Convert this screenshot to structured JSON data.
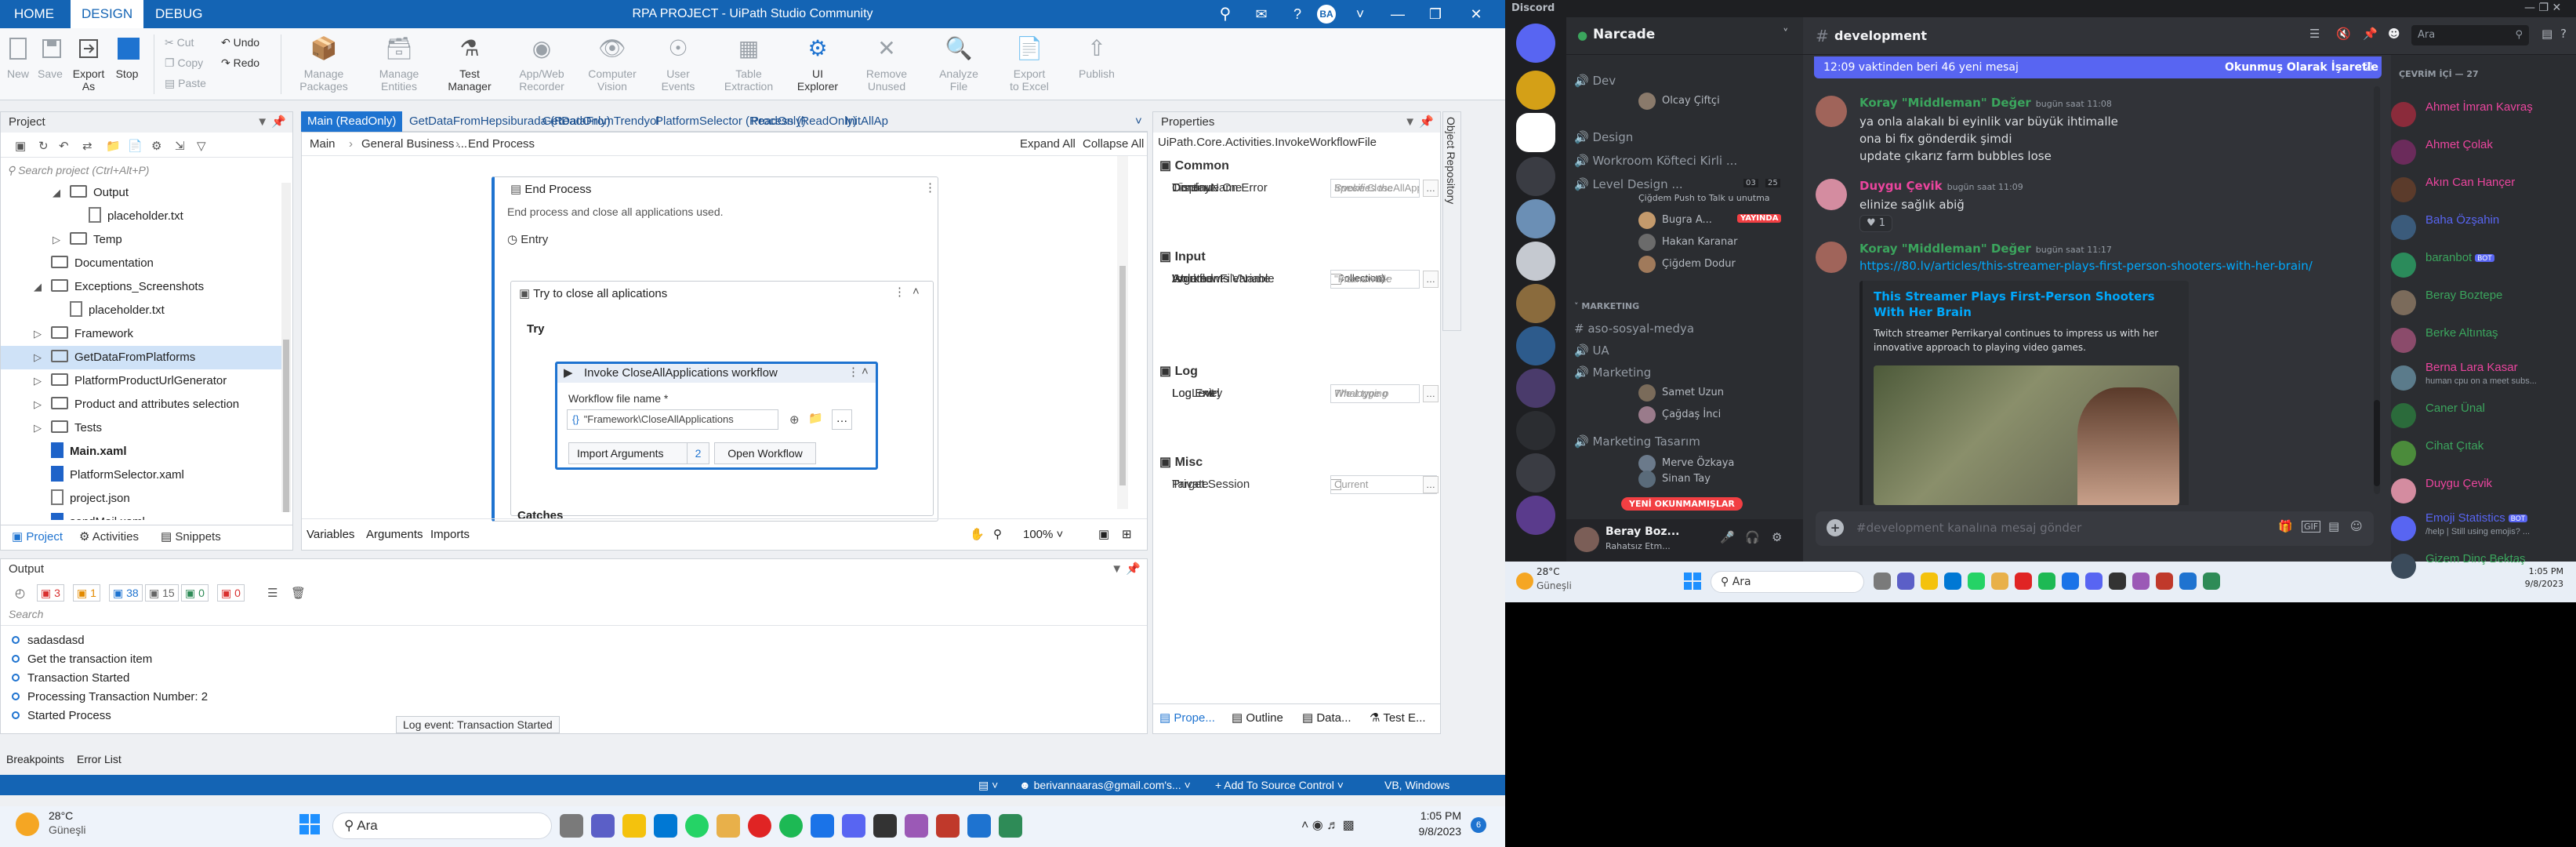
{
  "uipath": {
    "title": "RPA PROJECT - UiPath Studio Community",
    "tabs": [
      "HOME",
      "DESIGN",
      "DEBUG"
    ],
    "avatar": "BA",
    "ribbon": {
      "new": "New",
      "save": "Save",
      "export": "Export\nAs",
      "stop": "Stop",
      "cut": "Cut",
      "copy": "Copy",
      "paste": "Paste",
      "undo": "Undo",
      "redo": "Redo",
      "big": [
        {
          "label": "Manage\nPackages",
          "dis": true
        },
        {
          "label": "Manage\nEntities",
          "dis": true
        },
        {
          "label": "Test\nManager",
          "dis": false
        },
        {
          "label": "App/Web\nRecorder",
          "dis": true
        },
        {
          "label": "Computer\nVision",
          "dis": true
        },
        {
          "label": "User\nEvents",
          "dis": true
        },
        {
          "label": "Table\nExtraction",
          "dis": true
        },
        {
          "label": "UI\nExplorer",
          "dis": false
        },
        {
          "label": "Remove\nUnused",
          "dis": true
        },
        {
          "label": "Analyze\nFile",
          "dis": true
        },
        {
          "label": "Export\nto Excel",
          "dis": true
        },
        {
          "label": "Publish",
          "dis": true
        }
      ]
    },
    "project": {
      "title": "Project",
      "search_placeholder": "Search project (Ctrl+Alt+P)",
      "items": [
        {
          "label": "Output",
          "type": "folder",
          "level": 1,
          "open": true
        },
        {
          "label": "placeholder.txt",
          "type": "file",
          "level": 2
        },
        {
          "label": "Temp",
          "type": "folder",
          "level": 1,
          "open": false
        },
        {
          "label": "Documentation",
          "type": "folder",
          "level": 0,
          "open": null
        },
        {
          "label": "Exceptions_Screenshots",
          "type": "folder",
          "level": 0,
          "open": true
        },
        {
          "label": "placeholder.txt",
          "type": "file",
          "level": 1
        },
        {
          "label": "Framework",
          "type": "folder",
          "level": 0,
          "open": false
        },
        {
          "label": "GetDataFromPlatforms",
          "type": "folder",
          "level": 0,
          "open": false,
          "selected": true
        },
        {
          "label": "PlatformProductUrlGenerator",
          "type": "folder",
          "level": 0,
          "open": false
        },
        {
          "label": "Product and attributes selection",
          "type": "folder",
          "level": 0,
          "open": false
        },
        {
          "label": "Tests",
          "type": "folder",
          "level": 0,
          "open": false
        },
        {
          "label": "Main.xaml",
          "type": "xaml",
          "level": 0,
          "bold": true
        },
        {
          "label": "PlatformSelector.xaml",
          "type": "xaml",
          "level": 0
        },
        {
          "label": "project.json",
          "type": "file",
          "level": 0
        },
        {
          "label": "sendMail.xaml",
          "type": "xaml",
          "level": 0
        }
      ],
      "bottom_tabs": [
        "Project",
        "Activities",
        "Snippets"
      ]
    },
    "doc_tabs": [
      "Main (ReadOnly)",
      "GetDataFromHepsiburada (ReadOnly)",
      "GetDataFromTrendyol",
      "PlatformSelector (ReadOnly)",
      "Process (ReadOnly)",
      "InitAllAp"
    ],
    "breadcrumb": [
      "Main",
      "General Business ...",
      "End Process"
    ],
    "expand_all": "Expand All",
    "collapse_all": "Collapse All",
    "designer": {
      "end_process": "End Process",
      "end_desc": "End process and close all applications used.",
      "entry": "Entry",
      "try_catch": "Try to close all aplications",
      "try": "Try",
      "invoke": "Invoke CloseAllApplications workflow",
      "wf_label": "Workflow file name *",
      "wf_value": "\"Framework\\CloseAllApplications",
      "import_args": "Import Arguments",
      "import_count": "2",
      "open_workflow": "Open Workflow",
      "catches": "Catches",
      "bottom": [
        "Variables",
        "Arguments",
        "Imports"
      ],
      "zoom": "100%"
    },
    "properties": {
      "title": "Properties",
      "activity": "UiPath.Core.Activities.InvokeWorkflowFile",
      "sections": [
        {
          "name": "Common",
          "rows": [
            {
              "label": "Continue On Error",
              "value": "Specifie"
            },
            {
              "label": "DisplayName",
              "value": "Invoke CloseAllAppli"
            },
            {
              "label": "Timeout",
              "value": "Specifies the"
            }
          ]
        },
        {
          "name": "Input",
          "rows": [
            {
              "label": "Arguments",
              "value": "(Collection)"
            },
            {
              "label": "Arguments Variable",
              "value": "Enter a VB e"
            },
            {
              "label": "Isolated",
              "value": ""
            },
            {
              "label": "WorkflowFileName",
              "value": "\"Framework"
            }
          ]
        },
        {
          "name": "Log",
          "rows": [
            {
              "label": "Log Entry",
              "value": "What type o"
            },
            {
              "label": "Log Exit",
              "value": "What type o"
            },
            {
              "label": "LogLevel",
              "value": "The logging"
            }
          ]
        },
        {
          "name": "Misc",
          "rows": [
            {
              "label": "Private",
              "value": ""
            },
            {
              "label": "Target Session",
              "value": "Current"
            }
          ]
        }
      ],
      "bottom_tabs": [
        "Prope...",
        "Outline",
        "Data...",
        "Test E..."
      ]
    },
    "side_tab": "Object Repository",
    "output": {
      "title": "Output",
      "counts": [
        "3",
        "1",
        "38",
        "15",
        "0",
        "0"
      ],
      "search": "Search",
      "rows": [
        "sadasdasd",
        "Get the transaction item",
        "Transaction Started",
        "Processing Transaction Number: 2",
        "Started Process"
      ],
      "tooltip": "Log event: Transaction Started"
    },
    "status_tabs": [
      "Breakpoints",
      "Error List"
    ],
    "statusbar": {
      "email": "berivannaaras@gmail.com's...",
      "source": "Add To Source Control",
      "lang": "VB, Windows"
    },
    "taskbar": {
      "weather_temp": "28°C",
      "weather_desc": "Güneşli",
      "search": "Ara",
      "time": "1:05 PM",
      "date": "9/8/2023"
    }
  },
  "discord": {
    "app": "Discord",
    "server": "Narcade",
    "channel": "development",
    "new_msgs_bar": "12:09 vaktinden beri 46 yeni mesaj",
    "mark_read": "Okunmuş Olarak İşaretle",
    "search": "Ara",
    "channels": [
      {
        "type": "voice",
        "name": "Dev"
      },
      {
        "type": "voice",
        "name": "Design"
      },
      {
        "type": "voice",
        "name": "Workroom Köfteci Kirli ..."
      },
      {
        "type": "voice",
        "name": "Level Design ..."
      },
      {
        "type": "cat",
        "name": "MARKETING"
      },
      {
        "type": "text",
        "name": "aso-sosyal-medya"
      },
      {
        "type": "voice",
        "name": "UA"
      },
      {
        "type": "voice",
        "name": "Marketing"
      },
      {
        "type": "voice",
        "name": "Marketing Tasarım"
      }
    ],
    "voice_users": {
      "dev": [
        "Olcay Çiftçi"
      ],
      "level": [
        "Çiğdem Push to Talk u unutma",
        "Bugra A...",
        "Hakan Karanar",
        "Çiğdem Dodur"
      ],
      "level_live": "YAYINDA",
      "level_counts": [
        "03",
        "25"
      ],
      "marketing": [
        "Samet Uzun",
        "Çağdaş İnci"
      ],
      "tasarim": [
        "Merve Özkaya",
        "Sinan Tay"
      ]
    },
    "unread_pill": "YENİ OKUNMAMIŞLAR",
    "user": {
      "name": "Beray Boz...",
      "status": "Rahatsız Etm..."
    },
    "messages": [
      {
        "name": "Koray \"Middleman\" Değer",
        "time": "bugün saat 11:08",
        "color": "#3ba55d",
        "lines": [
          "ya onla alakalı bi eyinlik var büyük ihtimalle",
          "ona bi fix gönderdik şimdi",
          "update çıkarız farm bubbles lose"
        ]
      },
      {
        "name": "Duygu Çevik",
        "time": "bugün saat 11:09",
        "color": "#eb459e",
        "lines": [
          "elinize sağlık abiğ"
        ],
        "reaction": "1"
      },
      {
        "name": "Koray \"Middleman\" Değer",
        "time": "bugün saat 11:17",
        "color": "#3ba55d",
        "lines": [],
        "link": "https://80.lv/articles/this-streamer-plays-first-person-shooters-with-her-brain/",
        "embed_title": "This Streamer Plays First-Person Shooters With Her Brain",
        "embed_desc": "Twitch streamer Perrikaryal continues to impress us with her innovative approach to playing video games."
      }
    ],
    "input_placeholder": "#development kanalına mesaj gönder",
    "members_header": "ÇEVRİM İÇİ — 27",
    "members": [
      {
        "name": "Ahmet İmran Kavraş",
        "color": "#eb459e"
      },
      {
        "name": "Ahmet Çolak",
        "color": "#eb459e"
      },
      {
        "name": "Akın Can Hançer",
        "color": "#eb459e"
      },
      {
        "name": "Baha Özşahin",
        "color": "#5865f2"
      },
      {
        "name": "baranbot",
        "color": "#3ba55d",
        "bot": "BOT"
      },
      {
        "name": "Beray Boztepe",
        "color": "#3ba55d"
      },
      {
        "name": "Berke Altıntaş",
        "color": "#3ba55d"
      },
      {
        "name": "Berna Lara Kasar",
        "color": "#eb459e",
        "sub": "human cpu on a meet subs..."
      },
      {
        "name": "Caner Ünal",
        "color": "#3ba55d"
      },
      {
        "name": "Cihat Çıtak",
        "color": "#3ba55d"
      },
      {
        "name": "Duygu Çevik",
        "color": "#eb459e"
      },
      {
        "name": "Emoji Statistics",
        "color": "#5865f2",
        "bot": "BOT",
        "sub": "/help | Still using emojis? ..."
      },
      {
        "name": "Gizem Dinç Bektaş",
        "color": "#3ba55d"
      }
    ],
    "taskbar": {
      "weather_temp": "28°C",
      "weather_desc": "Güneşli",
      "search": "Ara",
      "time": "1:05 PM",
      "date": "9/8/2023"
    }
  }
}
